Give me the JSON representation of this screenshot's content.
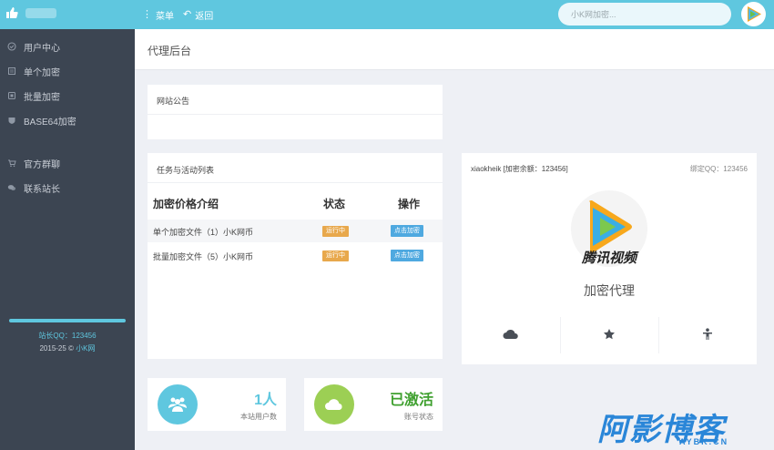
{
  "topbar": {
    "menu_label": "菜单",
    "back_label": "返回",
    "search_placeholder": "小K网加密..."
  },
  "sidebar": {
    "items": [
      {
        "label": "用户中心",
        "icon": "user-circle-icon"
      },
      {
        "label": "单个加密",
        "icon": "file-icon"
      },
      {
        "label": "批量加密",
        "icon": "stack-icon"
      },
      {
        "label": "BASE64加密",
        "icon": "shield-icon"
      },
      {
        "label": "官方群聊",
        "icon": "cart-icon"
      },
      {
        "label": "联系站长",
        "icon": "chat-icon"
      }
    ],
    "qq": "站长QQ：123456",
    "copyright_year": "2015-25 ©",
    "copyright_link": "小K网"
  },
  "page": {
    "title": "代理后台"
  },
  "notice": {
    "title": "网站公告"
  },
  "tasks": {
    "title": "任务与活动列表",
    "headers": [
      "加密价格介绍",
      "状态",
      "操作"
    ],
    "rows": [
      {
        "name": "单个加密文件（1）小K网币",
        "status": "运行中",
        "action": "点击加密"
      },
      {
        "name": "批量加密文件（5）小K网币",
        "status": "运行中",
        "action": "点击加密"
      }
    ]
  },
  "profile": {
    "user": "xiaokheik [加密余额：123456]",
    "qq": "绑定QQ：123456",
    "logo_text": "腾讯视频",
    "role": "加密代理",
    "icons": [
      "cloud-icon",
      "star-icon",
      "person-icon"
    ]
  },
  "stats": [
    {
      "value": "1人",
      "label": "本站用户数",
      "icon": "users-icon"
    },
    {
      "value": "已激活",
      "label": "账号状态",
      "icon": "cloud-icon"
    }
  ],
  "watermark": {
    "main": "阿影博客",
    "sub": "AYBK.CN"
  },
  "colors": {
    "topbar": "#5fc7df",
    "sidebar": "#3c4552",
    "status_badge": "#e8a84c",
    "action_button": "#4fa9e0",
    "stat_green": "#3fa02f"
  }
}
